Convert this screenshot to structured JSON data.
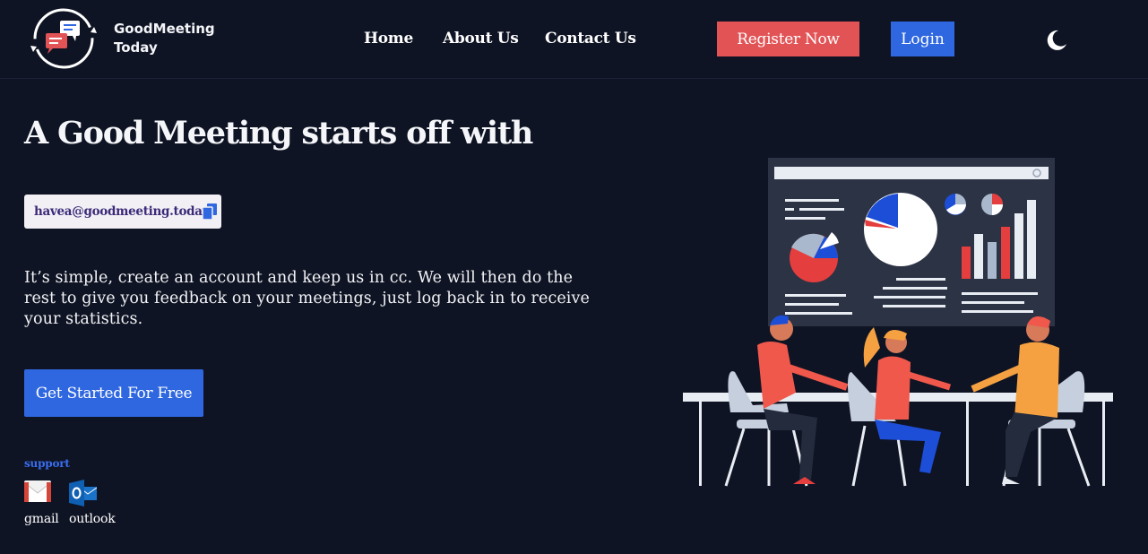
{
  "brand": {
    "line1": "GoodMeeting",
    "line2": "Today"
  },
  "nav": {
    "home": "Home",
    "about": "About Us",
    "contact": "Contact Us"
  },
  "actions": {
    "register": "Register Now",
    "login": "Login"
  },
  "hero": {
    "title": "A Good Meeting starts off with",
    "email": "havea@goodmeeting.today",
    "description": "It’s simple, create an account and keep us in cc. We will then do the rest to give you feedback on your meetings, just log back in to receive your statistics.",
    "cta": "Get Started For Free"
  },
  "support": {
    "label": "support",
    "gmail": "gmail",
    "outlook": "outlook"
  },
  "icons": {
    "logo": "chat-bubbles-cycle-logo",
    "theme_toggle": "moon-icon",
    "copy": "copy-icon",
    "gmail": "gmail-icon",
    "outlook": "outlook-icon"
  },
  "colors": {
    "background": "#0f1424",
    "accent_blue": "#2f67e0",
    "accent_red": "#e25356",
    "support_label": "#3a6ef0"
  }
}
